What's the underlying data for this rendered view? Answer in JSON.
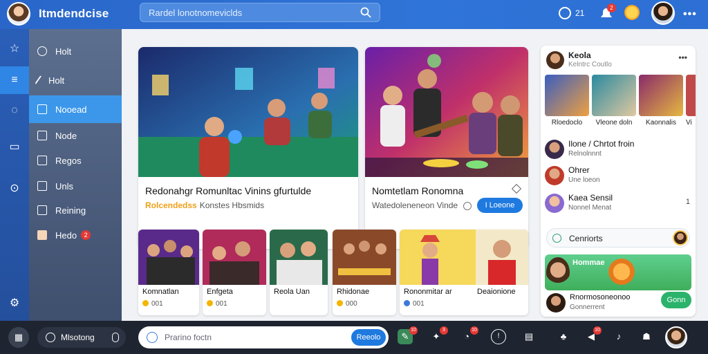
{
  "header": {
    "app_title": "Itmdendcise",
    "search_placeholder": "Rardel lonotnomeviclds",
    "clock_count": "21",
    "notif_count": "2"
  },
  "sidebar": {
    "items": [
      {
        "label": "Holt",
        "icon": "heart-icon"
      },
      {
        "label": "Holt",
        "icon": "pen-icon"
      },
      {
        "label": "Nooead",
        "icon": "card-icon"
      },
      {
        "label": "Node",
        "icon": "doc-icon"
      },
      {
        "label": "Regos",
        "icon": "image-icon"
      },
      {
        "label": "Unls",
        "icon": "chart-icon"
      },
      {
        "label": "Reining",
        "icon": "list-icon"
      },
      {
        "label": "Hedo",
        "icon": "book-icon",
        "badge": "2"
      }
    ]
  },
  "hero": [
    {
      "title": "Redonahgr Romunltac Vinins gfurtulde",
      "tag": "Rolcendedss",
      "sub": "Konstes Hbsmids"
    },
    {
      "title": "Nomtetlam Ronomna",
      "sub": "Watedoleneneon Vinde",
      "button": "I Loeone"
    }
  ],
  "thumbs": [
    {
      "title": "Komnatlan",
      "meta": "001"
    },
    {
      "title": "Enfgeta",
      "meta": "001"
    },
    {
      "title": "Reola Uan",
      "meta": ""
    },
    {
      "title": "Rhidonae",
      "meta": "000"
    },
    {
      "title": "Rononmitar ar",
      "meta": "001"
    },
    {
      "title": "Deaionione",
      "meta": ""
    }
  ],
  "right_panel": {
    "name": "Keola",
    "sub": "Kelntrc Coutlo",
    "mini": [
      "Rloedoclo",
      "Vleone doln",
      "Kaonnalis",
      "Vi"
    ],
    "friends": [
      {
        "name": "Ilone / Chrtot froin",
        "sub": "Relnolnnnt"
      },
      {
        "name": "Ohrer",
        "sub": "Une loeon"
      },
      {
        "name": "Kaea Sensil",
        "sub": "Nonnel Menat",
        "count": "1"
      }
    ],
    "comments_label": "Cenriorts",
    "promo_title": "Hommae",
    "footer_text": "Rnormosoneonoo",
    "footer_sub": "Gonnerrent",
    "join_label": "Gonn"
  },
  "bottombar": {
    "meeting_label": "Mlsotong",
    "input_placeholder": "Prarino foctn",
    "send_label": "Reeolo"
  }
}
